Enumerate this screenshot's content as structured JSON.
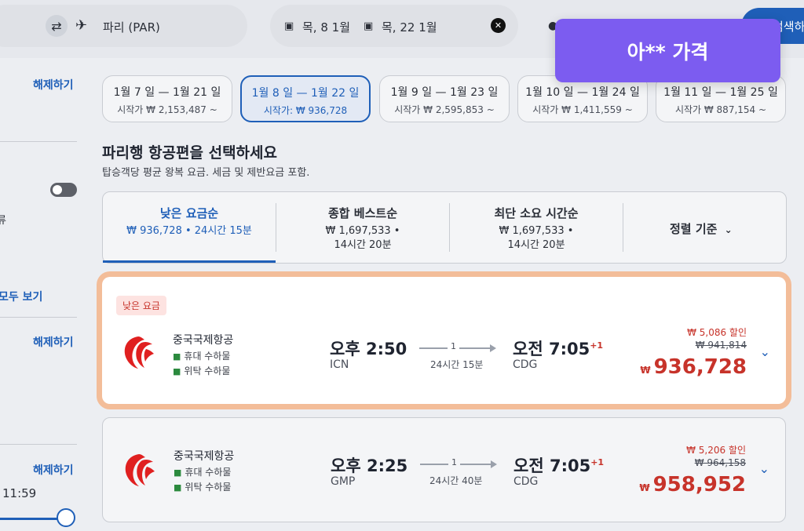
{
  "search_bar": {
    "destination": "파리 (PAR)",
    "depart_date": "목, 8 1월",
    "return_date": "목, 22 1월",
    "search_button": "검색하기"
  },
  "toast": {
    "text": "아** 가격"
  },
  "sidebar": {
    "clear_1": "해제하기",
    "clear_2": "해제하기",
    "clear_3": "해제하기",
    "view_all": "모두 보기",
    "partial_text": "류",
    "time_label": "11:59"
  },
  "date_tabs": [
    {
      "range": "1월 7 일 — 1월 21 일",
      "price": "시작가 ₩ 2,153,487 ~"
    },
    {
      "range": "1월 8 일 — 1월 22 일",
      "price": "시작가: ₩ 936,728"
    },
    {
      "range": "1월 9 일 — 1월 23 일",
      "price": "시작가 ₩ 2,595,853 ~"
    },
    {
      "range": "1월 10 일 — 1월 24 일",
      "price": "시작가 ₩ 1,411,559 ~"
    },
    {
      "range": "1월 11 일 — 1월 25 일",
      "price": "시작가 ₩ 887,154 ~"
    }
  ],
  "heading": "파리행 항공편을 선택하세요",
  "subheading": "탑승객당 평균 왕복 요금. 세금 및 제반요금 포함.",
  "sort": {
    "tabs": [
      {
        "label": "낮은 요금순",
        "line1": "₩ 936,728 • 24시간 15분",
        "line2": ""
      },
      {
        "label": "종합 베스트순",
        "line1": "₩ 1,697,533 •",
        "line2": "14시간 20분"
      },
      {
        "label": "최단 소요 시간순",
        "line1": "₩ 1,697,533 •",
        "line2": "14시간 20분"
      }
    ],
    "criteria": "정렬 기준"
  },
  "flights": [
    {
      "badge": "낮은 요금",
      "airline": "중국국제항공",
      "carry_on": "휴대 수하물",
      "checked": "위탁 수하물",
      "depart_time": "오후 2:50",
      "depart_airport": "ICN",
      "stops": "1",
      "duration": "24시간 15분",
      "arrive_time": "오전 7:05",
      "day_offset": "+1",
      "arrive_airport": "CDG",
      "discount": "₩ 5,086 할인",
      "original_price": "₩ 941,814",
      "currency": "₩",
      "price": "936,728"
    },
    {
      "badge": "",
      "airline": "중국국제항공",
      "carry_on": "휴대 수하물",
      "checked": "위탁 수하물",
      "depart_time": "오후 2:25",
      "depart_airport": "GMP",
      "stops": "1",
      "duration": "24시간 40분",
      "arrive_time": "오전 7:05",
      "day_offset": "+1",
      "arrive_airport": "CDG",
      "discount": "₩ 5,206 할인",
      "original_price": "₩ 964,158",
      "currency": "₩",
      "price": "958,952"
    }
  ],
  "colors": {
    "accent": "#1f5fb8",
    "price_red": "#c7332a",
    "toast": "#7c5cf0",
    "highlight_ring": "#f3bd99"
  }
}
